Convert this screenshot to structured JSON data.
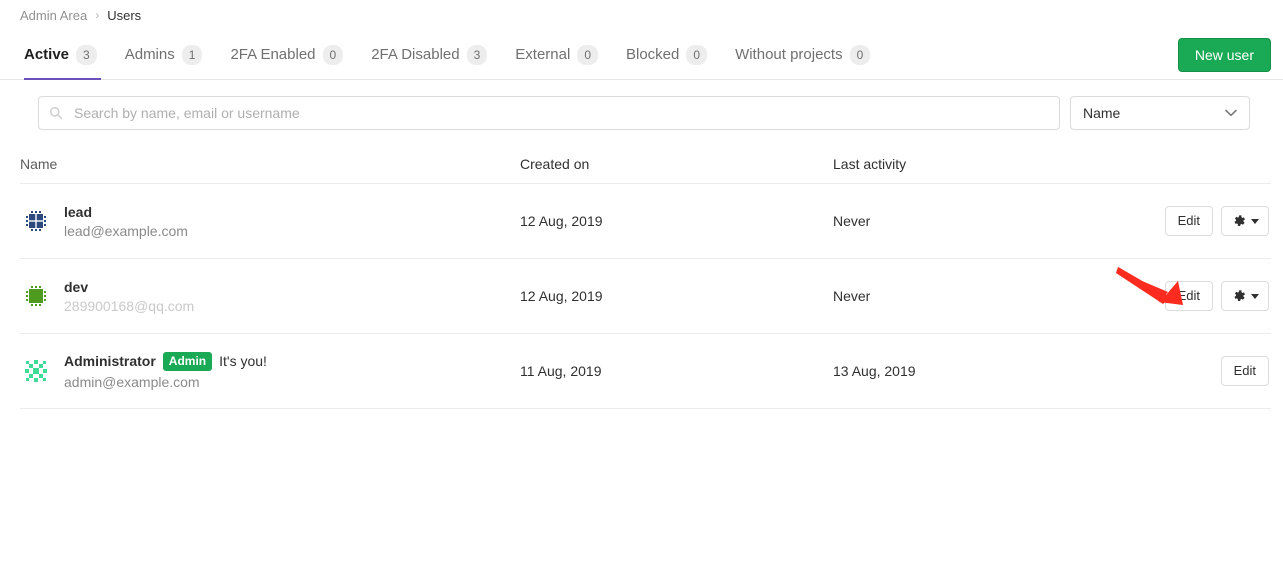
{
  "breadcrumb": {
    "parent": "Admin Area",
    "separator": "›",
    "current": "Users"
  },
  "tabs": [
    {
      "label": "Active",
      "count": "3",
      "active": true
    },
    {
      "label": "Admins",
      "count": "1",
      "active": false
    },
    {
      "label": "2FA Enabled",
      "count": "0",
      "active": false
    },
    {
      "label": "2FA Disabled",
      "count": "3",
      "active": false
    },
    {
      "label": "External",
      "count": "0",
      "active": false
    },
    {
      "label": "Blocked",
      "count": "0",
      "active": false
    },
    {
      "label": "Without projects",
      "count": "0",
      "active": false
    }
  ],
  "actions": {
    "new_user_label": "New user"
  },
  "search": {
    "placeholder": "Search by name, email or username",
    "value": "",
    "icon": "search-icon"
  },
  "sort": {
    "selected": "Name",
    "icon": "chevron-down-icon"
  },
  "table": {
    "headers": {
      "name": "Name",
      "created_on": "Created on",
      "last_activity": "Last activity"
    },
    "rows": [
      {
        "name": "lead",
        "email": "lead@example.com",
        "email_faded": false,
        "badge": "",
        "its_you": "",
        "created_on": "12 Aug, 2019",
        "last_activity": "Never",
        "edit_label": "Edit",
        "has_gear": true,
        "avatar_color": "#2e4a7d"
      },
      {
        "name": "dev",
        "email": "289900168@qq.com",
        "email_faded": true,
        "badge": "",
        "its_you": "",
        "created_on": "12 Aug, 2019",
        "last_activity": "Never",
        "edit_label": "Edit",
        "has_gear": true,
        "avatar_color": "#4f9b1f"
      },
      {
        "name": "Administrator",
        "email": "admin@example.com",
        "email_faded": false,
        "badge": "Admin",
        "its_you": "It's you!",
        "created_on": "11 Aug, 2019",
        "last_activity": "13 Aug, 2019",
        "edit_label": "Edit",
        "has_gear": false,
        "avatar_color": "#3ddc97"
      }
    ]
  },
  "colors": {
    "brand_green": "#1aaa55",
    "active_tab_underline": "#6b4fbb",
    "annotation_arrow": "#fb2b1f"
  },
  "annotation": {
    "arrow": "red-arrow-pointing-to-edit-button"
  }
}
